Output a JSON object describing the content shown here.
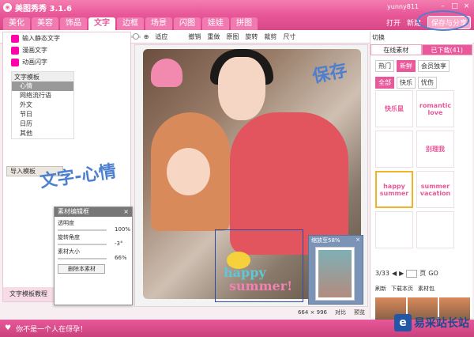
{
  "app": {
    "title": "美图秀秀 3.1.6",
    "user": "yunny811"
  },
  "menu": {
    "tabs": [
      "美化",
      "美容",
      "饰品",
      "文字",
      "边框",
      "场景",
      "闪图",
      "娃娃",
      "拼图"
    ],
    "active": 3
  },
  "topright": {
    "open": "打开",
    "new": "新建",
    "save": "保存与分享"
  },
  "toolbar": {
    "rotate": "旋转",
    "crop": "裁剪",
    "size": "尺寸",
    "undo": "撤销",
    "redo": "重做",
    "original": "原图",
    "fit": "适应"
  },
  "leftpanel": {
    "items": [
      "输入静态文字",
      "漫画文字",
      "动画闪字"
    ],
    "tree_head": "文字模板",
    "tree_items": [
      "心情",
      "网络流行语",
      "外文",
      "节日",
      "日历",
      "其他"
    ],
    "import": "导入模板",
    "bottom": "文字模板教程"
  },
  "material": {
    "title": "素材编辑框",
    "opacity_label": "透明度",
    "opacity_val": "100%",
    "rotate_label": "旋转角度",
    "rotate_val": "-3°",
    "size_label": "素材大小",
    "size_val": "66%",
    "delete": "删除本素材"
  },
  "thumb": {
    "title": "缩放至58%"
  },
  "status": {
    "dims": "664 × 996",
    "compare": "对比",
    "preview": "预览"
  },
  "rightpanel": {
    "switch": "切换",
    "tabs": [
      "在线素材",
      "已下载(41)"
    ],
    "sub": [
      "热门",
      "新鲜",
      "会员独享"
    ],
    "filters": [
      "全部",
      "快乐",
      "忧伤"
    ],
    "stickers": [
      "快乐鼠",
      "romantic love",
      "",
      "别理我",
      "happy summer",
      "summer vacation",
      "",
      ""
    ],
    "pager": "3/33",
    "page_label": "页",
    "go": "GO",
    "refresh": "刷新",
    "download": "下载本页",
    "library": "素材包"
  },
  "photo": {
    "happy": "happy",
    "summer": "summer!"
  },
  "bottom": {
    "message": "你不是一个人在伢孕！"
  },
  "watermark": {
    "text": "易采站长站"
  },
  "annotations": {
    "save": "保存",
    "text": "文字-心情"
  }
}
